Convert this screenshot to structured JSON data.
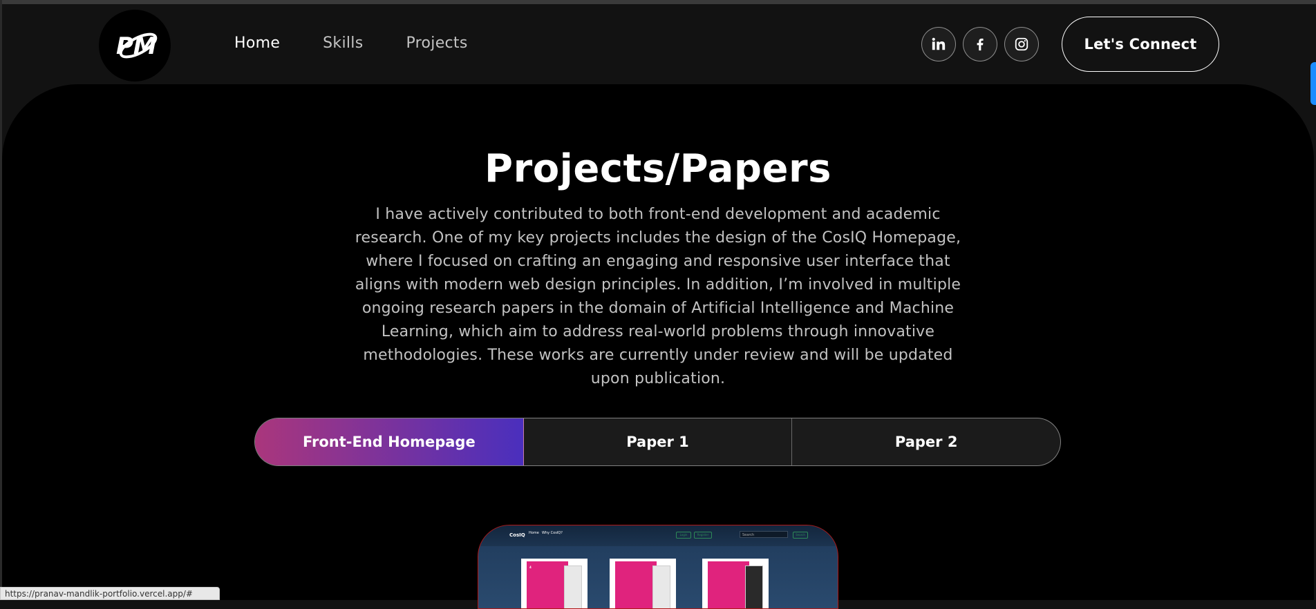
{
  "navbar": {
    "logo_text": "PM",
    "links": [
      {
        "label": "Home"
      },
      {
        "label": "Skills"
      },
      {
        "label": "Projects"
      }
    ],
    "social": [
      "linkedin-icon",
      "facebook-icon",
      "instagram-icon"
    ],
    "connect_label": "Let's Connect"
  },
  "projects": {
    "title": "Projects/Papers",
    "description": "I have actively contributed to both front-end development and academic research. One of my key projects includes the design of the CosIQ Homepage, where I focused on crafting an engaging and responsive user interface that aligns with modern web design principles. In addition, I’m involved in multiple ongoing research papers in the domain of Artificial Intelligence and Machine Learning, which aim to address real-world problems through innovative methodologies. These works are currently under review and will be updated upon publication.",
    "tabs": [
      {
        "label": "Front-End Homepage",
        "active": true
      },
      {
        "label": "Paper 1",
        "active": false
      },
      {
        "label": "Paper 2",
        "active": false
      }
    ]
  },
  "preview": {
    "logo": "CosIQ",
    "links": [
      "Home",
      "Why CosIQ?"
    ],
    "buttons": [
      "Login",
      "Register",
      "Search"
    ],
    "search_placeholder": "Search",
    "product_number": "4"
  },
  "status_bar": {
    "url": "https://pranav-mandlik-portfolio.vercel.app/#"
  },
  "colors": {
    "accent_start": "#aa367c",
    "accent_end": "#4a2fbd",
    "scroll_tab": "#1a8cff"
  }
}
